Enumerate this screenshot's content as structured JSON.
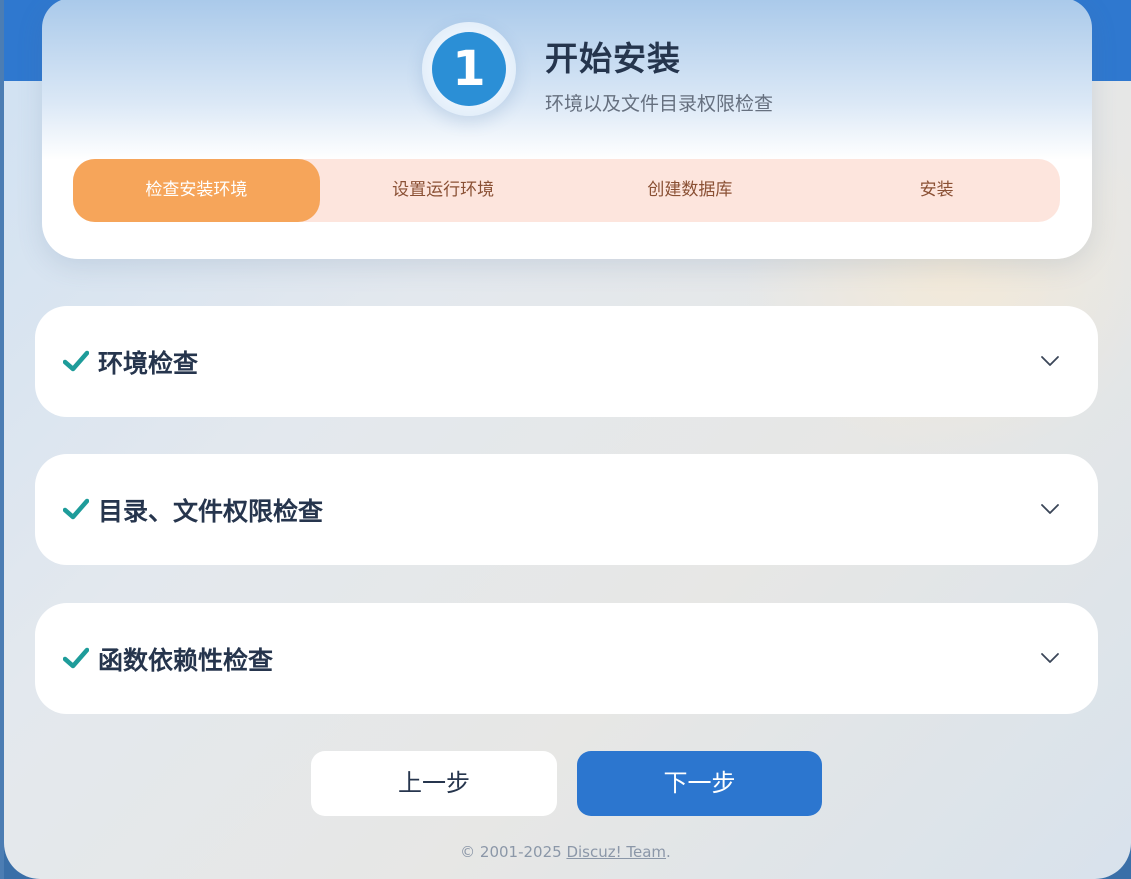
{
  "header": {
    "step_number": "1",
    "title": "开始安装",
    "subtitle": "环境以及文件目录权限检查"
  },
  "steps": [
    {
      "label": "检查安装环境",
      "active": true
    },
    {
      "label": "设置运行环境",
      "active": false
    },
    {
      "label": "创建数据库",
      "active": false
    },
    {
      "label": "安装",
      "active": false
    }
  ],
  "panels": [
    {
      "title": "环境检查",
      "icon": "check-icon",
      "expand_icon": "chevron-down-icon"
    },
    {
      "title": "目录、文件权限检查",
      "icon": "check-icon",
      "expand_icon": "chevron-down-icon"
    },
    {
      "title": "函数依赖性检查",
      "icon": "check-icon",
      "expand_icon": "chevron-down-icon"
    }
  ],
  "buttons": {
    "prev_label": "上一步",
    "next_label": "下一步"
  },
  "footer": {
    "copyright": "© 2001-2025 ",
    "link_text": "Discuz! Team",
    "suffix": "."
  },
  "colors": {
    "accent_blue": "#2c76cf",
    "step_active": "#f6a55a",
    "step_bg": "#fde5dd",
    "check_color": "#1e9c9a"
  }
}
